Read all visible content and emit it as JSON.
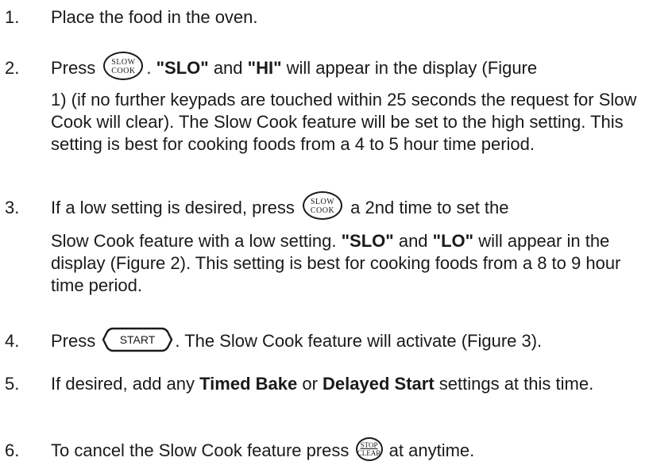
{
  "steps": [
    {
      "number": "1.",
      "line1": "Place the food in the oven."
    },
    {
      "number": "2.",
      "pre": "Press",
      "key": {
        "top": "SLOW",
        "bottom": "COOK"
      },
      "post_a": ". ",
      "bold_a": "\"SLO\"",
      "mid_a": " and ",
      "bold_b": "\"HI\"",
      "post_b": " will appear in the display  (Figure",
      "body": "1) (if no further keypads are touched within 25 seconds the request for Slow Cook will clear). The Slow Cook feature will be set to the  high setting. This setting is best for cooking foods from a 4 to 5 hour time period."
    },
    {
      "number": "3.",
      "pre": "If a low setting is desired, press",
      "key": {
        "top": "SLOW",
        "bottom": "COOK"
      },
      "post": " a 2nd time to set the",
      "body_a": "Slow Cook feature with a low setting.  ",
      "bold_a": "\"SLO\"",
      "mid_a": " and ",
      "bold_b": "\"LO\"",
      "body_b": " will appear in the display  (Figure 2). This setting is best for cooking foods from a 8 to 9 hour time period."
    },
    {
      "number": "4.",
      "pre": "Press",
      "key": "START",
      "post": ". The Slow Cook feature will activate (Figure 3)."
    },
    {
      "number": "5.",
      "pre": "If desired, add any ",
      "bold_a": "Timed Bake",
      "mid": " or ",
      "bold_b": "Delayed Start",
      "post": " settings at this time."
    },
    {
      "number": "6.",
      "pre": "To cancel the Slow Cook feature press",
      "key": {
        "top": "STOP",
        "bottom": "CLEAR"
      },
      "post": " at anytime."
    }
  ]
}
